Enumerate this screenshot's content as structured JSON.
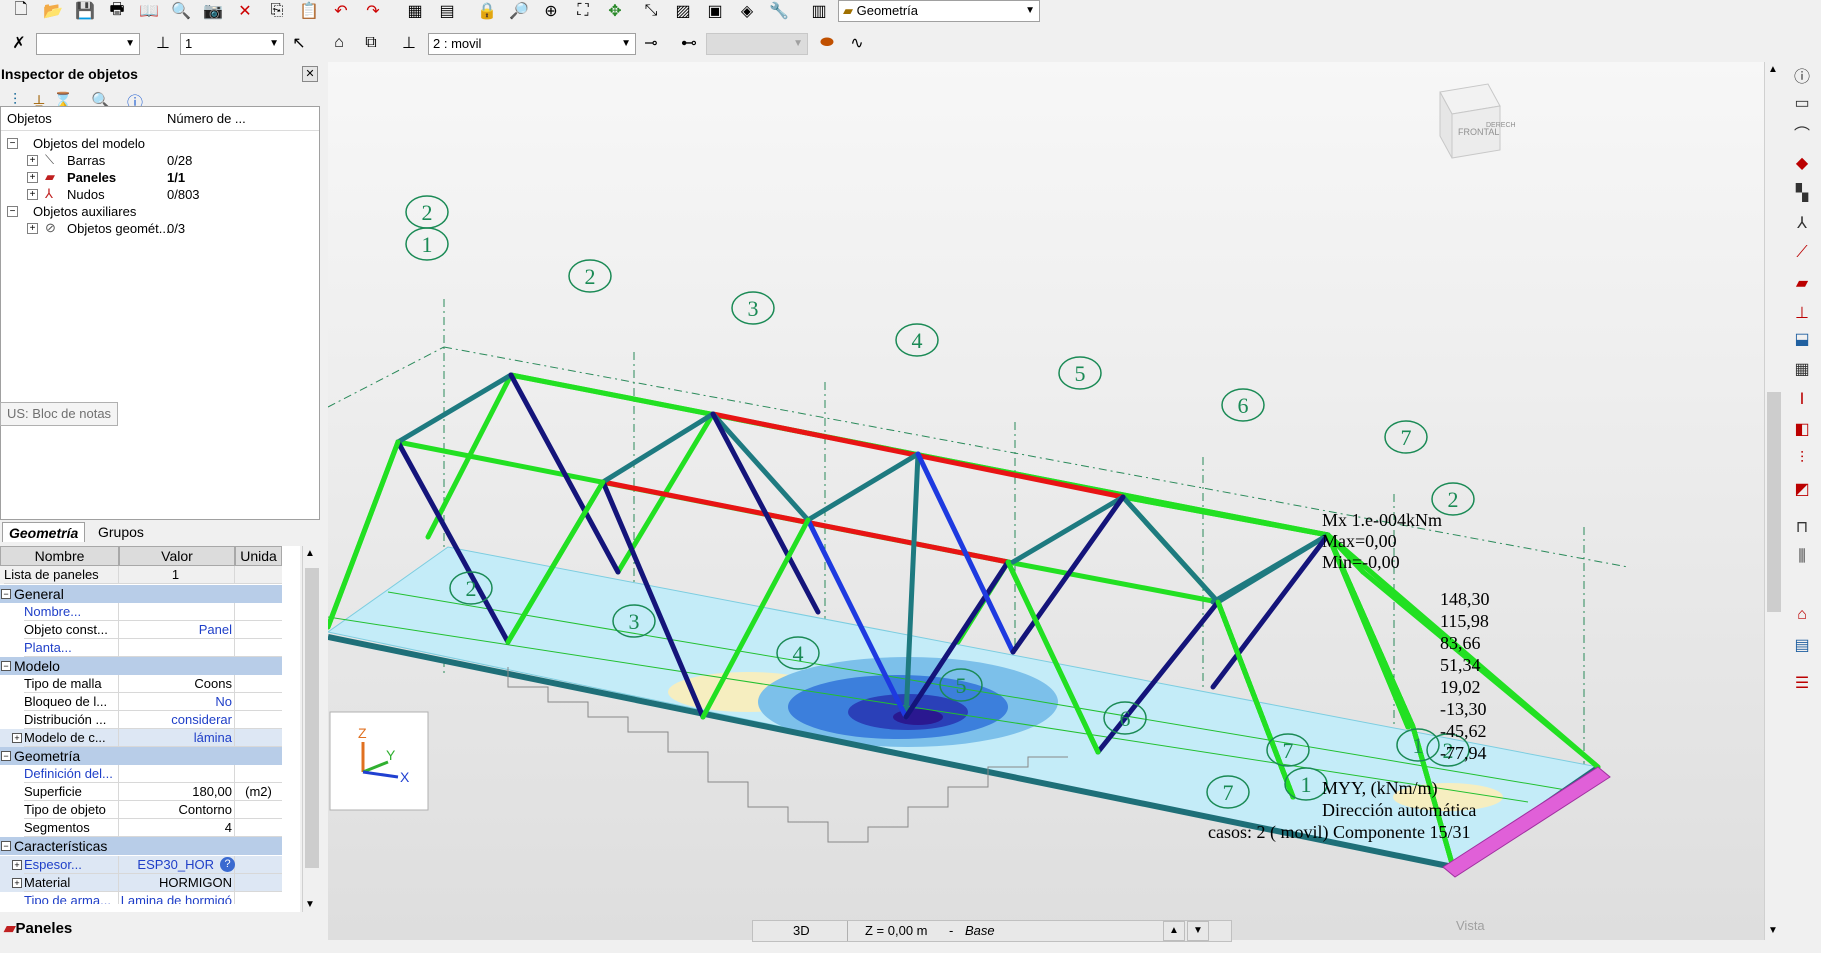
{
  "toolbar": {
    "view_select": "Geometría",
    "layer_value": "1",
    "case_select": "2 : movil",
    "first_combo": "",
    "disabled_combo": ""
  },
  "inspector": {
    "title": "Inspector de objetos",
    "col_objects": "Objetos",
    "col_number": "Número de ...",
    "tree": [
      {
        "label": "Objetos del modelo",
        "value": ""
      },
      {
        "label": "Barras",
        "value": "0/28"
      },
      {
        "label": "Paneles",
        "value": "1/1"
      },
      {
        "label": "Nudos",
        "value": "0/803"
      },
      {
        "label": "Objetos auxiliares",
        "value": ""
      },
      {
        "label": "Objetos geomét...",
        "value": "0/3"
      }
    ],
    "notepad_tooltip": "US: Bloc de notas",
    "tabs": [
      "Geometría",
      "Grupos"
    ]
  },
  "properties": {
    "headers": [
      "Nombre",
      "Valor",
      "Unida"
    ],
    "list_label": "Lista de paneles",
    "list_value": "1",
    "sections": {
      "general": "General",
      "modelo": "Modelo",
      "geometria": "Geometría",
      "caracteristicas": "Características"
    },
    "rows": {
      "nombre": {
        "name": "Nombre...",
        "value": "",
        "unit": ""
      },
      "objeto": {
        "name": "Objeto const...",
        "value": "Panel",
        "unit": ""
      },
      "planta": {
        "name": "Planta...",
        "value": "",
        "unit": ""
      },
      "malla": {
        "name": "Tipo de malla",
        "value": "Coons",
        "unit": ""
      },
      "bloqueo": {
        "name": "Bloqueo de l...",
        "value": "No",
        "unit": ""
      },
      "distrib": {
        "name": "Distribución ...",
        "value": "considerar",
        "unit": ""
      },
      "modeloc": {
        "name": "Modelo de c...",
        "value": "lámina",
        "unit": ""
      },
      "definicion": {
        "name": "Definición del...",
        "value": "",
        "unit": ""
      },
      "superficie": {
        "name": "Superficie",
        "value": "180,00",
        "unit": "(m2)"
      },
      "tipoobj": {
        "name": "Tipo de objeto",
        "value": "Contorno",
        "unit": ""
      },
      "segmentos": {
        "name": "Segmentos",
        "value": "4",
        "unit": ""
      },
      "espesor": {
        "name": "Espesor...",
        "value": "ESP30_HOR",
        "unit": ""
      },
      "material": {
        "name": "Material",
        "value": "HORMIGON",
        "unit": ""
      },
      "armado": {
        "name": "Tipo de arma...",
        "value": "Lamina de hormigó",
        "unit": ""
      }
    },
    "bottom_tab": "Paneles"
  },
  "viewport": {
    "cube_front": "FRONTAL",
    "cube_side": "DERECH",
    "axis_labels": [
      "Z",
      "Y",
      "X"
    ],
    "results": {
      "mx_line": "Mx  1.e-004kNm",
      "max_line": "Max=0,00",
      "min_line": "Min=-0,00",
      "legend_values": [
        "148,30",
        "115,98",
        "83,66",
        "51,34",
        "19,02",
        "-13,30",
        "-45,62",
        "-77,94"
      ],
      "quantity": "MYY, (kNm/m)",
      "direction": "Dirección automática",
      "cases": "casos: 2 ( movil) Componente 15/31"
    },
    "view_label": "Vista",
    "grid_labels": [
      "1",
      "2",
      "3",
      "4",
      "5",
      "6",
      "7"
    ]
  },
  "status": {
    "mode": "3D",
    "level": "Z = 0,00 m",
    "level_name": "Base"
  },
  "colors": {
    "chord_green": "#22e022",
    "diagonal_navy": "#14147a",
    "teal": "#1e7a80",
    "red_member": "#e81414",
    "label_green": "#1a8a55"
  }
}
